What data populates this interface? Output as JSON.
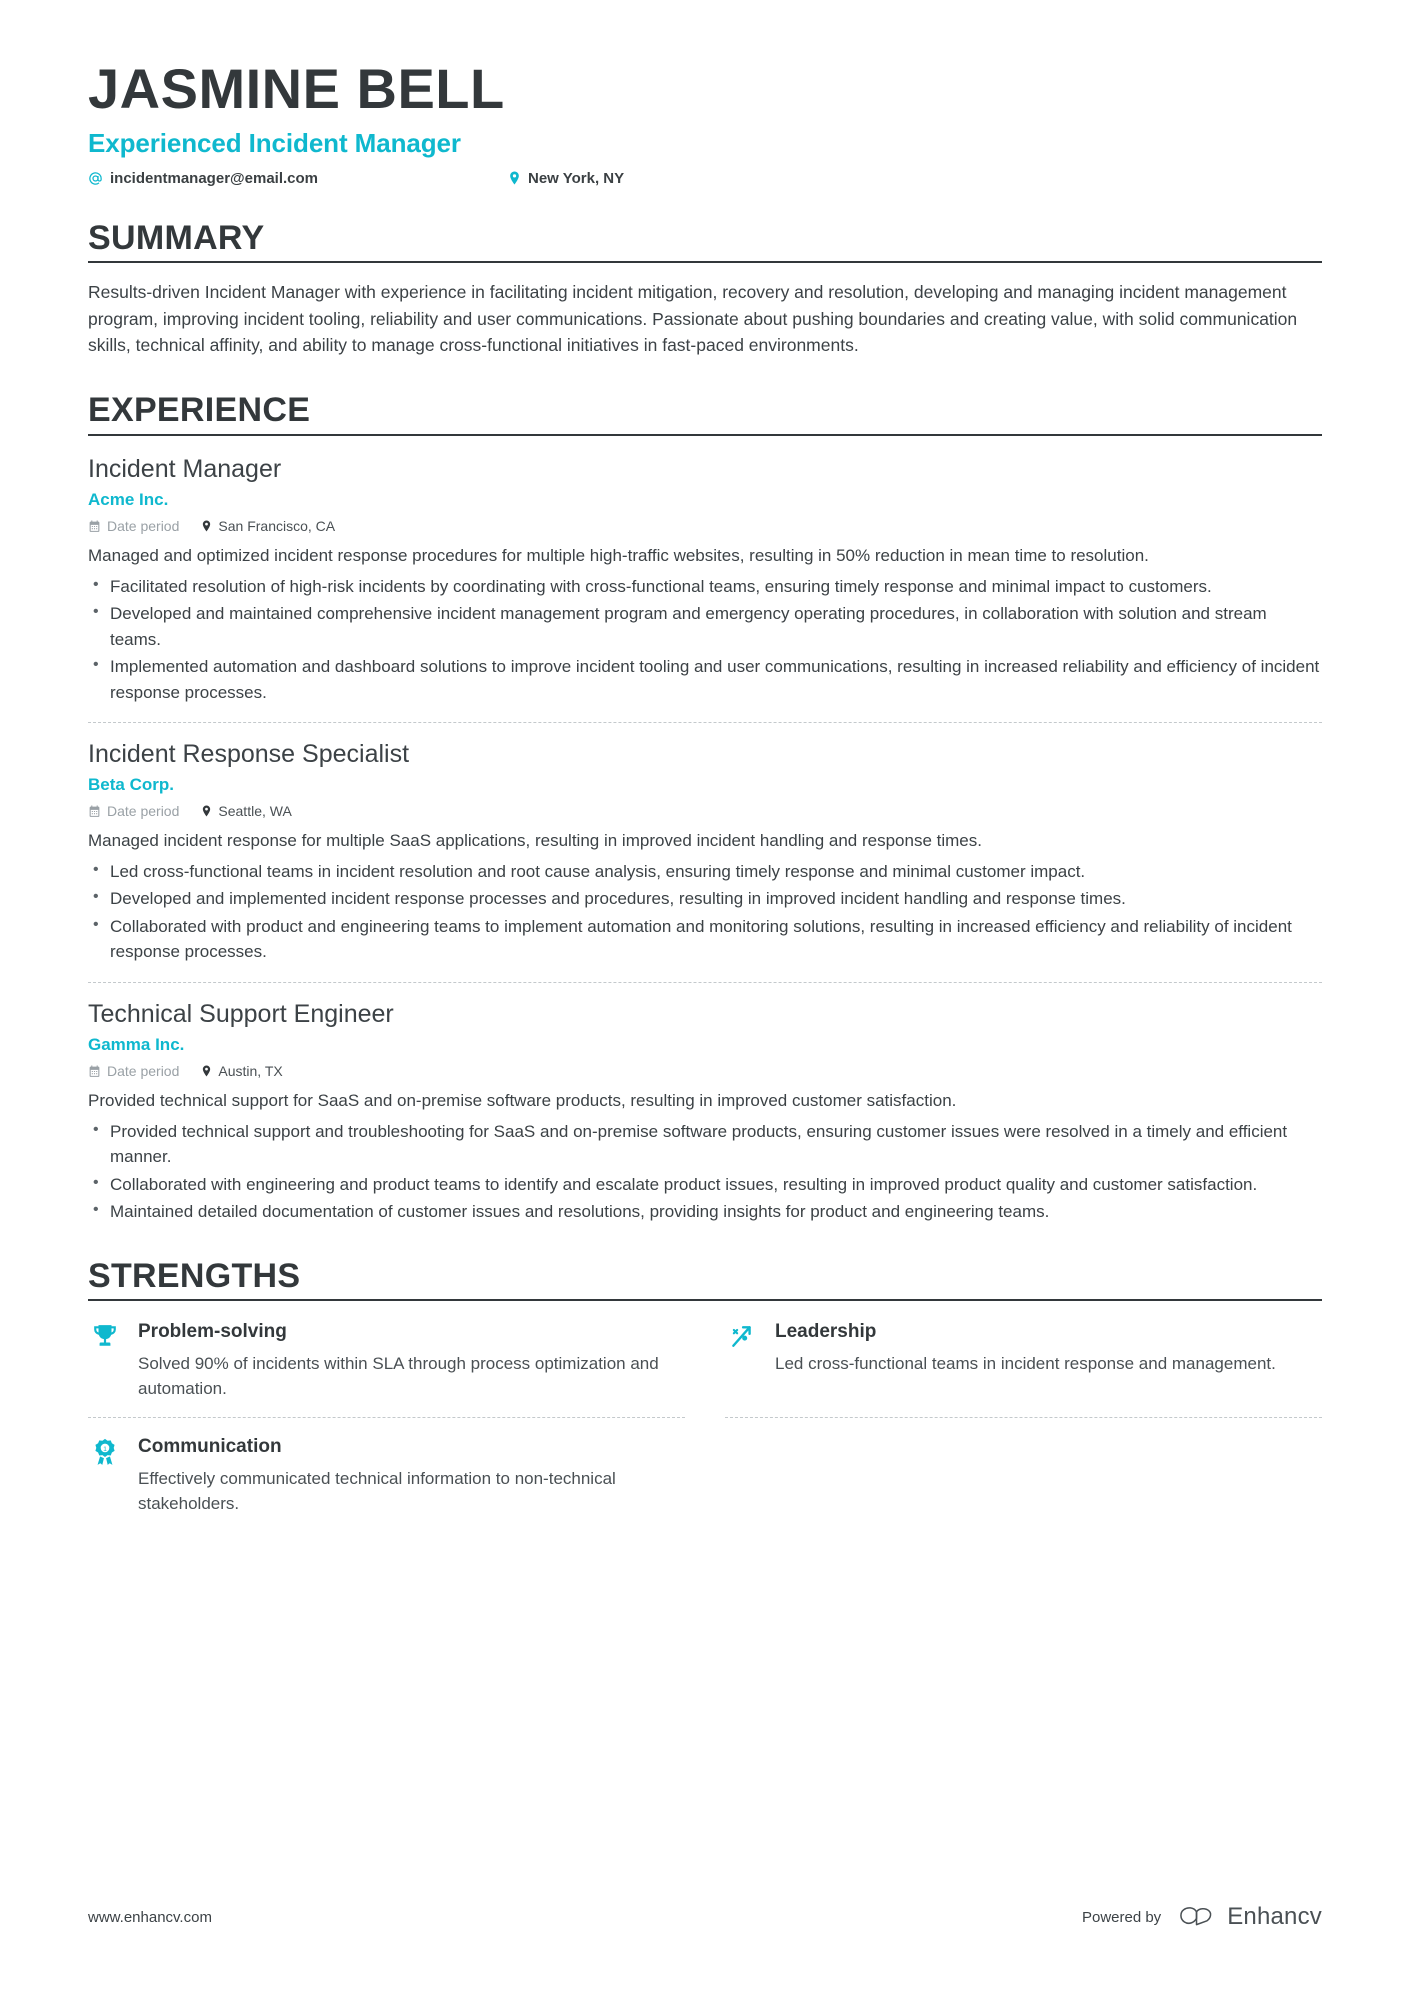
{
  "theme": {
    "accent": "#0FB8CE",
    "ink": "#33383b",
    "body": "#3c4246",
    "muted": "#9aa1a6"
  },
  "header": {
    "full_name": "JASMINE BELL",
    "job_title": "Experienced Incident Manager",
    "email_icon": "at-icon",
    "email": "incidentmanager@email.com",
    "location_icon": "location-pin-icon",
    "location": "New York, NY"
  },
  "summary": {
    "heading": "SUMMARY",
    "text": "Results-driven Incident Manager with experience in facilitating incident mitigation, recovery and resolution, developing and managing incident management program, improving incident tooling, reliability and user communications. Passionate about pushing boundaries and creating value, with solid communication skills, technical affinity, and ability to manage cross-functional initiatives in fast-paced environments."
  },
  "experience": {
    "heading": "EXPERIENCE",
    "jobs": [
      {
        "role": "Incident Manager",
        "company": "Acme Inc.",
        "date_icon": "calendar-icon",
        "date": "Date period",
        "location_icon": "location-pin-icon",
        "location": "San Francisco, CA",
        "description": "Managed and optimized incident response procedures for multiple high-traffic websites, resulting in 50% reduction in mean time to resolution.",
        "bullets": [
          "Facilitated resolution of high-risk incidents by coordinating with cross-functional teams, ensuring timely response and minimal impact to customers.",
          "Developed and maintained comprehensive incident management program and emergency operating procedures, in collaboration with solution and stream teams.",
          "Implemented automation and dashboard solutions to improve incident tooling and user communications, resulting in increased reliability and efficiency of incident response processes."
        ]
      },
      {
        "role": "Incident Response Specialist",
        "company": "Beta Corp.",
        "date_icon": "calendar-icon",
        "date": "Date period",
        "location_icon": "location-pin-icon",
        "location": "Seattle, WA",
        "description": "Managed incident response for multiple SaaS applications, resulting in improved incident handling and response times.",
        "bullets": [
          "Led cross-functional teams in incident resolution and root cause analysis, ensuring timely response and minimal customer impact.",
          "Developed and implemented incident response processes and procedures, resulting in improved incident handling and response times.",
          "Collaborated with product and engineering teams to implement automation and monitoring solutions, resulting in increased efficiency and reliability of incident response processes."
        ]
      },
      {
        "role": "Technical Support Engineer",
        "company": "Gamma Inc.",
        "date_icon": "calendar-icon",
        "date": "Date period",
        "location_icon": "location-pin-icon",
        "location": "Austin, TX",
        "description": "Provided technical support for SaaS and on-premise software products, resulting in improved customer satisfaction.",
        "bullets": [
          "Provided technical support and troubleshooting for SaaS and on-premise software products, ensuring customer issues were resolved in a timely and efficient manner.",
          "Collaborated with engineering and product teams to identify and escalate product issues, resulting in improved product quality and customer satisfaction.",
          "Maintained detailed documentation of customer issues and resolutions, providing insights for product and engineering teams."
        ]
      }
    ]
  },
  "strengths": {
    "heading": "STRENGTHS",
    "items": [
      {
        "icon": "trophy-icon",
        "title": "Problem-solving",
        "description": "Solved 90% of incidents within SLA through process optimization and automation."
      },
      {
        "icon": "growth-arrow-icon",
        "title": "Leadership",
        "description": "Led cross-functional teams in incident response and management."
      },
      {
        "icon": "award-ribbon-icon",
        "title": "Communication",
        "description": "Effectively communicated technical information to non-technical stakeholders."
      }
    ]
  },
  "footer": {
    "url": "www.enhancv.com",
    "powered_by": "Powered by",
    "brand_logo_icon": "enhancv-logo-icon",
    "brand_name": "Enhancv"
  }
}
